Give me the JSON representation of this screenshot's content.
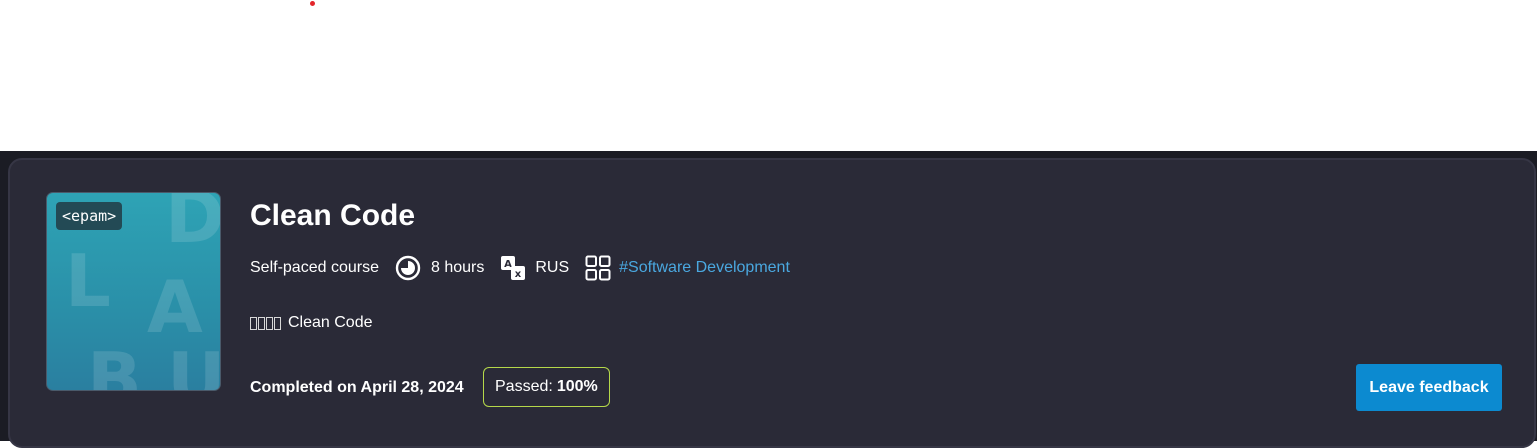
{
  "course": {
    "title": "Clean Code",
    "thumbnail": {
      "logo_text": "<epam>",
      "letters": [
        "D",
        "L",
        "A",
        "B",
        "U"
      ]
    },
    "meta": {
      "type": "Self-paced course",
      "duration": "8 hours",
      "duration_icon": "clock-icon",
      "language": "RUS",
      "language_icon": "translate-icon",
      "category_icon": "grid-icon",
      "category": "#Software Development"
    },
    "description": "Clean Code",
    "completed": "Completed on April 28, 2024",
    "passed_label": "Passed:",
    "passed_value": "100%",
    "feedback_button": "Leave feedback"
  },
  "colors": {
    "accent_blue": "#0c8ad0",
    "link_blue": "#4aa8e0",
    "passed_border": "#b5d84a",
    "card_bg": "#2a2a37",
    "red_dot": "#e3262b"
  }
}
